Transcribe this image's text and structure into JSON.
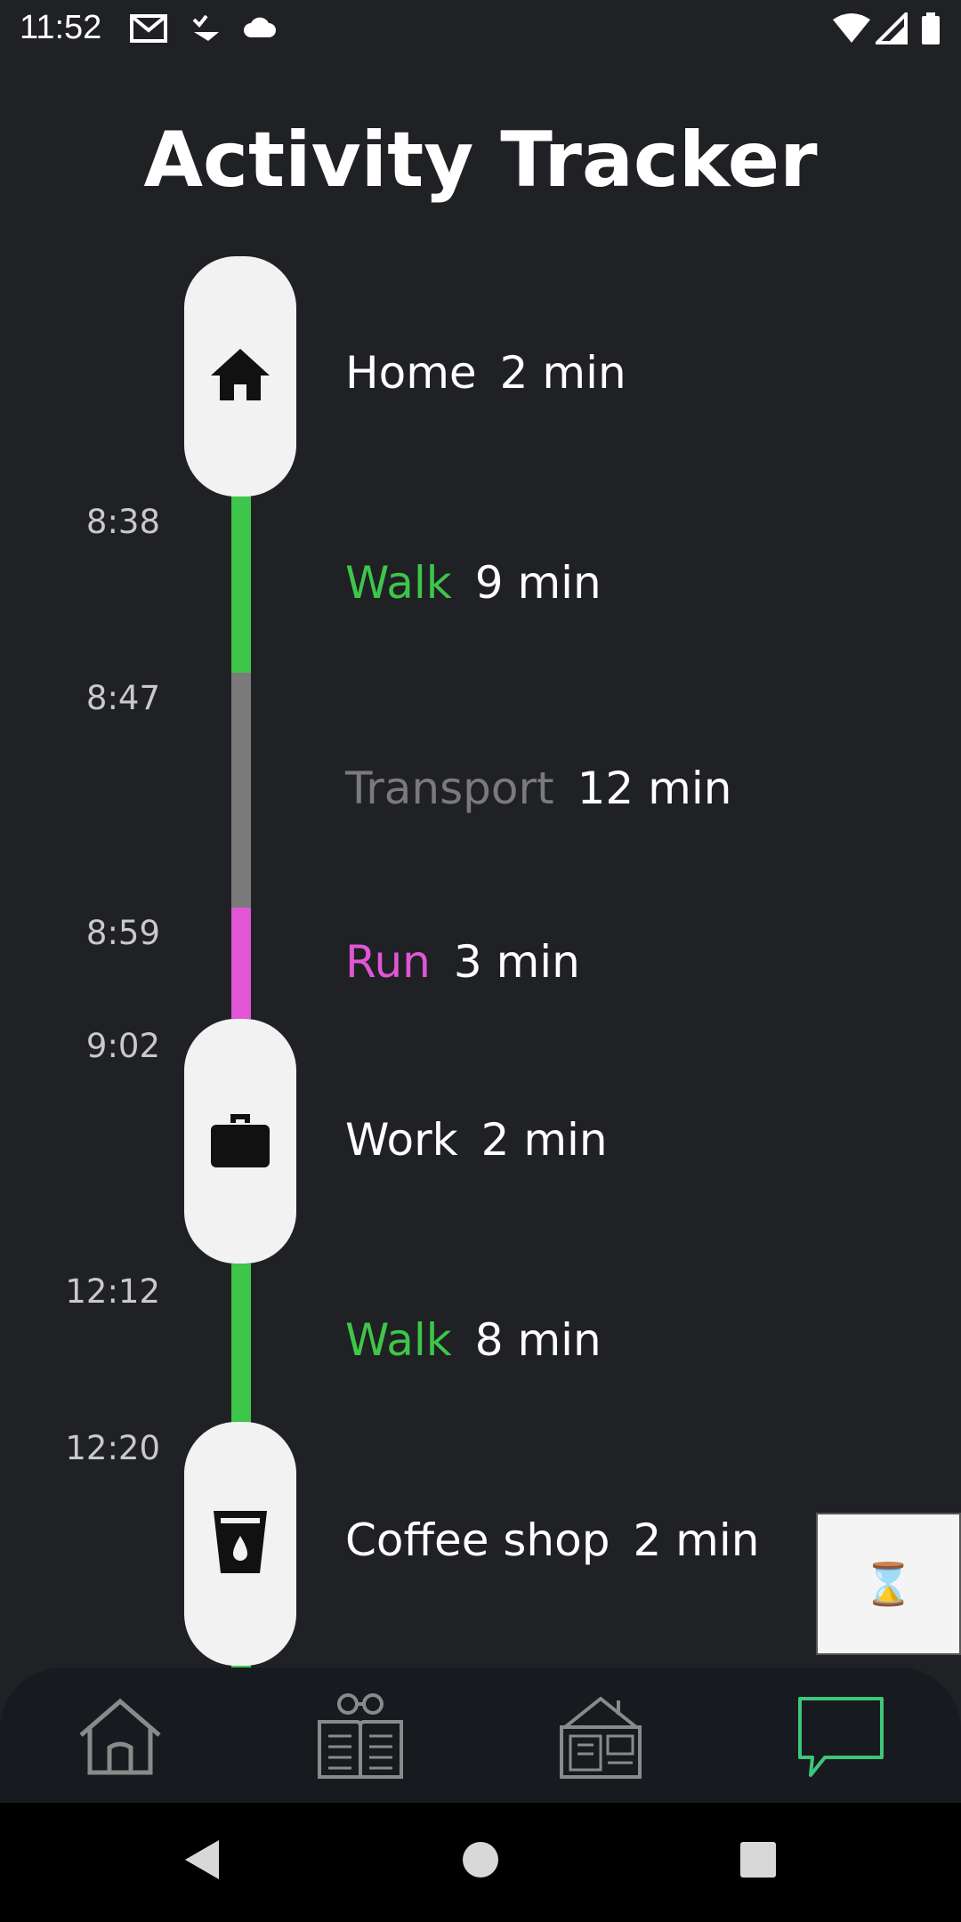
{
  "status_bar": {
    "time": "11:52",
    "icons": [
      "gmail-icon",
      "task-check-icon",
      "cloud-icon",
      "wifi-icon",
      "signal-icon",
      "battery-icon"
    ]
  },
  "page": {
    "title": "Activity Tracker"
  },
  "colors": {
    "background": "#202124",
    "walk": "#3ec64a",
    "transport": "#7a7a7a",
    "run": "#e056d5",
    "pill": "#f2f2f2",
    "nav_active": "#3ec67a"
  },
  "timeline": {
    "times": [
      "8:38",
      "8:47",
      "8:59",
      "9:02",
      "12:12",
      "12:20"
    ],
    "entries": [
      {
        "name": "Home",
        "duration": "2 min",
        "kind": "place",
        "icon": "home-icon"
      },
      {
        "name": "Walk",
        "duration": "9 min",
        "kind": "walk"
      },
      {
        "name": "Transport",
        "duration": "12 min",
        "kind": "transport"
      },
      {
        "name": "Run",
        "duration": "3 min",
        "kind": "run"
      },
      {
        "name": "Work",
        "duration": "2 min",
        "kind": "place",
        "icon": "briefcase-icon"
      },
      {
        "name": "Walk",
        "duration": "8 min",
        "kind": "walk"
      },
      {
        "name": "Coffee shop",
        "duration": "2 min",
        "kind": "place",
        "icon": "coffee-cup-icon"
      }
    ]
  },
  "floating_box": {
    "glyph": "⌛"
  },
  "bottom_nav": {
    "items": [
      {
        "icon": "home-outline-icon",
        "active": false
      },
      {
        "icon": "reader-book-icon",
        "active": false
      },
      {
        "icon": "house-plan-icon",
        "active": false
      },
      {
        "icon": "chat-bubble-icon",
        "active": true
      }
    ]
  },
  "system_nav": {
    "items": [
      "back-icon",
      "home-circle-icon",
      "recents-square-icon"
    ]
  }
}
